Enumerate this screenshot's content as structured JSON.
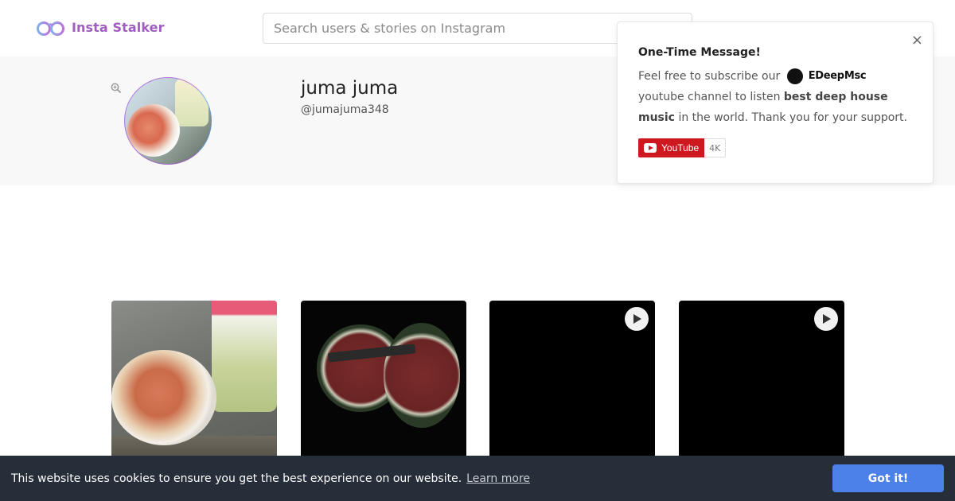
{
  "header": {
    "logo_text": "Insta Stalker",
    "logo_icon": "glasses-logo-icon",
    "search_placeholder": "Search users & stories on Instagram",
    "search_value": ""
  },
  "profile": {
    "name": "juma juma",
    "handle": "@jumajuma348",
    "zoom_icon": "zoom-in-icon"
  },
  "popup": {
    "title": "One-Time Message!",
    "text_before_brand": "Feel free to subscribe our",
    "brand_name": "EDeepMsc",
    "text_after_brand": "youtube channel to listen",
    "bold_text": "best deep house music",
    "text_end": "in the world. Thank you for your support.",
    "close_label": "×",
    "youtube_label": "YouTube",
    "youtube_count": "4K"
  },
  "posts": [
    {
      "type": "image",
      "icon": ""
    },
    {
      "type": "image",
      "icon": ""
    },
    {
      "type": "video",
      "icon": "play-icon"
    },
    {
      "type": "video",
      "icon": "play-icon"
    }
  ],
  "cookie": {
    "text": "This website uses cookies to ensure you get the best experience on our website.",
    "link_label": "Learn more",
    "button_label": "Got it!"
  },
  "colors": {
    "brand_purple": "#a05ec0",
    "cookie_bg": "#252e39",
    "cookie_button": "#4b81e8",
    "youtube_red": "#cc181e"
  }
}
